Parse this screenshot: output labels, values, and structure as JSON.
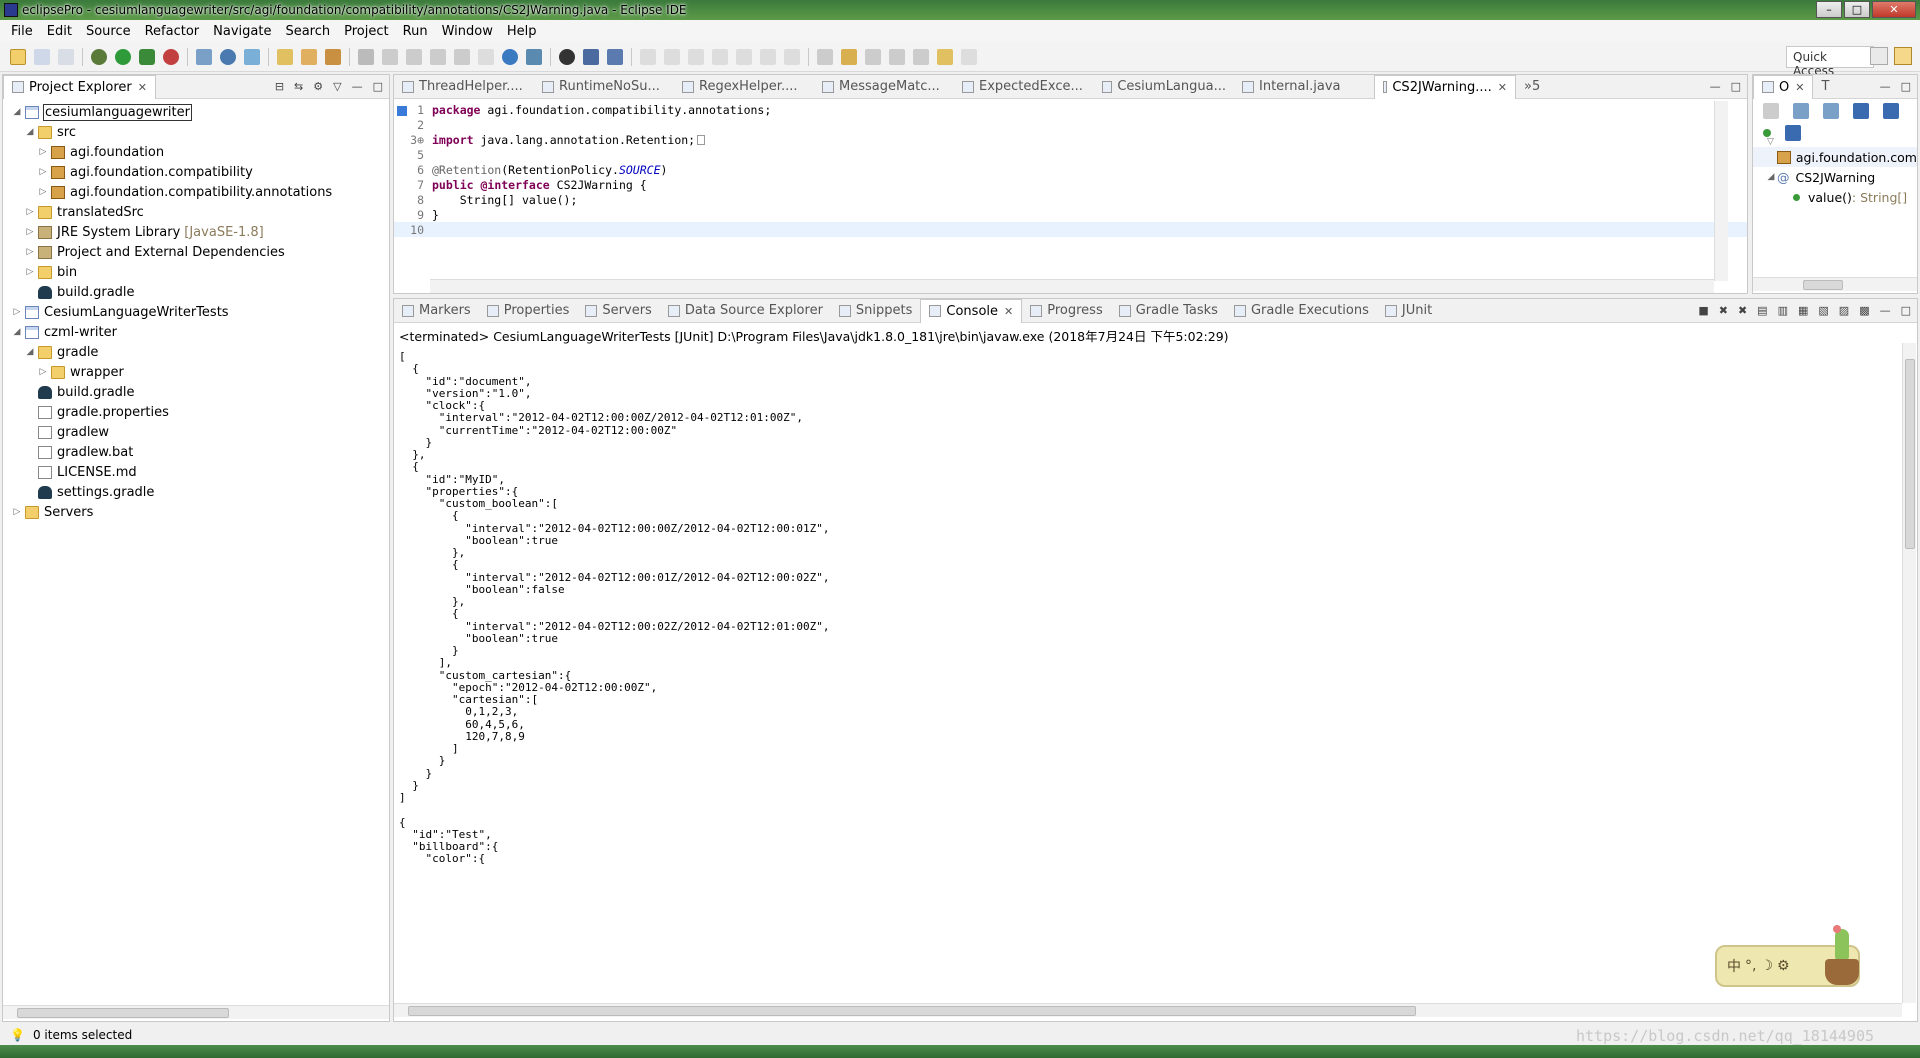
{
  "window": {
    "title": "eclipsePro - cesiumlanguagewriter/src/agi/foundation/compatibility/annotations/CS2JWarning.java - Eclipse IDE"
  },
  "menu": [
    "File",
    "Edit",
    "Source",
    "Refactor",
    "Navigate",
    "Search",
    "Project",
    "Run",
    "Window",
    "Help"
  ],
  "toolbar": {
    "quick_access": "Quick Access"
  },
  "project_explorer": {
    "title": "Project Explorer",
    "nodes": [
      {
        "label": "cesiumlanguagewriter",
        "indent": 0,
        "icon": "project",
        "expanded": true,
        "selected": true
      },
      {
        "label": "src",
        "indent": 1,
        "icon": "folder",
        "expanded": true
      },
      {
        "label": "agi.foundation",
        "indent": 2,
        "icon": "package",
        "expanded": false
      },
      {
        "label": "agi.foundation.compatibility",
        "indent": 2,
        "icon": "package",
        "expanded": false
      },
      {
        "label": "agi.foundation.compatibility.annotations",
        "indent": 2,
        "icon": "package",
        "expanded": false
      },
      {
        "label": "translatedSrc",
        "indent": 1,
        "icon": "folder",
        "expanded": false
      },
      {
        "label": "JRE System Library",
        "suffix": "[JavaSE-1.8]",
        "indent": 1,
        "icon": "library",
        "expanded": false
      },
      {
        "label": "Project and External Dependencies",
        "indent": 1,
        "icon": "library",
        "expanded": false
      },
      {
        "label": "bin",
        "indent": 1,
        "icon": "folder",
        "expanded": false
      },
      {
        "label": "build.gradle",
        "indent": 1,
        "icon": "gradle",
        "leaf": true
      },
      {
        "label": "CesiumLanguageWriterTests",
        "indent": 0,
        "icon": "project",
        "expanded": false
      },
      {
        "label": "czml-writer",
        "indent": 0,
        "icon": "project",
        "expanded": true
      },
      {
        "label": "gradle",
        "indent": 1,
        "icon": "folder",
        "expanded": true
      },
      {
        "label": "wrapper",
        "indent": 2,
        "icon": "folder",
        "expanded": false
      },
      {
        "label": "build.gradle",
        "indent": 1,
        "icon": "gradle",
        "leaf": true
      },
      {
        "label": "gradle.properties",
        "indent": 1,
        "icon": "file",
        "leaf": true
      },
      {
        "label": "gradlew",
        "indent": 1,
        "icon": "file",
        "leaf": true
      },
      {
        "label": "gradlew.bat",
        "indent": 1,
        "icon": "file",
        "leaf": true
      },
      {
        "label": "LICENSE.md",
        "indent": 1,
        "icon": "file",
        "leaf": true
      },
      {
        "label": "settings.gradle",
        "indent": 1,
        "icon": "gradle",
        "leaf": true
      },
      {
        "label": "Servers",
        "indent": 0,
        "icon": "folder",
        "expanded": false
      }
    ]
  },
  "editor": {
    "tabs": [
      "ThreadHelper....",
      "RuntimeNoSu...",
      "RegexHelper....",
      "MessageMatc...",
      "ExpectedExce...",
      "CesiumLangua...",
      "Internal.java",
      "CS2JWarning...."
    ],
    "active_tab": "CS2JWarning....",
    "overflow": "»5",
    "lines": [
      {
        "n": "1",
        "html": "package"
      },
      {
        "n": "2"
      },
      {
        "n": "3"
      },
      {
        "n": "4"
      },
      {
        "n": "5"
      },
      {
        "n": "6"
      },
      {
        "n": "7"
      },
      {
        "n": "8"
      },
      {
        "n": "9"
      },
      {
        "n": "10"
      }
    ],
    "code": {
      "l1_kw": "package",
      "l1_rest": " agi.foundation.compatibility.annotations;",
      "l3_kw": "import",
      "l3_rest": " java.lang.annotation.Retention;",
      "l6_ann": "@Retention",
      "l6_mid": "(RetentionPolicy.",
      "l6_const": "SOURCE",
      "l6_end": ")",
      "l7_kw": "public",
      "l7_kw2": " @interface",
      "l7_rest": " CS2JWarning {",
      "l8": "    String[] value();",
      "l9": "}"
    }
  },
  "outline": {
    "tabs": [
      "O",
      "T"
    ],
    "items": [
      {
        "label": "agi.foundation.com"
      },
      {
        "label": "CS2JWarning"
      },
      {
        "label": "value()",
        "type": " : String[]"
      }
    ]
  },
  "bottom_tabs": [
    "Markers",
    "Properties",
    "Servers",
    "Data Source Explorer",
    "Snippets",
    "Console",
    "Progress",
    "Gradle Tasks",
    "Gradle Executions",
    "JUnit"
  ],
  "bottom_active": "Console",
  "console": {
    "header": "<terminated> CesiumLanguageWriterTests [JUnit] D:\\Program Files\\Java\\jdk1.8.0_181\\jre\\bin\\javaw.exe (2018年7月24日 下午5:02:29)",
    "text": "[\n  {\n    \"id\":\"document\",\n    \"version\":\"1.0\",\n    \"clock\":{\n      \"interval\":\"2012-04-02T12:00:00Z/2012-04-02T12:01:00Z\",\n      \"currentTime\":\"2012-04-02T12:00:00Z\"\n    }\n  },\n  {\n    \"id\":\"MyID\",\n    \"properties\":{\n      \"custom_boolean\":[\n        {\n          \"interval\":\"2012-04-02T12:00:00Z/2012-04-02T12:00:01Z\",\n          \"boolean\":true\n        },\n        {\n          \"interval\":\"2012-04-02T12:00:01Z/2012-04-02T12:00:02Z\",\n          \"boolean\":false\n        },\n        {\n          \"interval\":\"2012-04-02T12:00:02Z/2012-04-02T12:01:00Z\",\n          \"boolean\":true\n        }\n      ],\n      \"custom_cartesian\":{\n        \"epoch\":\"2012-04-02T12:00:00Z\",\n        \"cartesian\":[\n          0,1,2,3,\n          60,4,5,6,\n          120,7,8,9\n        ]\n      }\n    }\n  }\n]\n\n{\n  \"id\":\"Test\",\n  \"billboard\":{\n    \"color\":{"
  },
  "status": {
    "text": "0 items selected"
  },
  "watermark": "https://blog.csdn.net/qq_18144905",
  "ime": {
    "label": "中"
  }
}
